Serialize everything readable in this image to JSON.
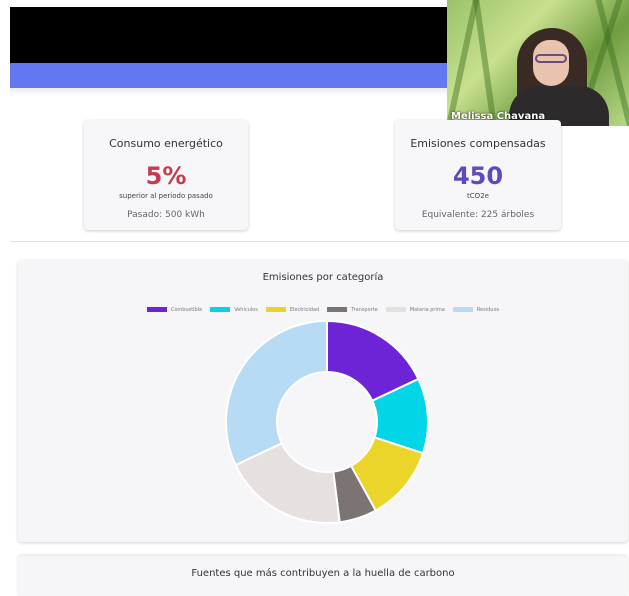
{
  "video": {
    "participant_name": "Melissa Chavana"
  },
  "cards": {
    "energy": {
      "title": "Consumo energético",
      "value": "5%",
      "subtitle": "superior al periodo pasado",
      "footer": "Pasado: 500 kWh",
      "color": "#c73a4f"
    },
    "emissions": {
      "title": "Emisiones compensadas",
      "value": "450",
      "subtitle": "tCO2e",
      "footer": "Equivalente: 225 árboles",
      "color": "#5a4bc2"
    }
  },
  "chart_data": {
    "type": "pie",
    "title": "Emisiones por categoría",
    "legend_position": "top",
    "categories": [
      "Combustible",
      "Vehículos",
      "Electricidad",
      "Transporte",
      "Materia prima",
      "Residuos"
    ],
    "values": [
      18,
      12,
      12,
      6,
      20,
      32
    ],
    "colors": [
      "#6d24d6",
      "#00d6e6",
      "#ecd52a",
      "#7b7374",
      "#e6e0e0",
      "#b7dbf5"
    ]
  },
  "bottom_section": {
    "title": "Fuentes que más contribuyen a la huella de carbono"
  }
}
